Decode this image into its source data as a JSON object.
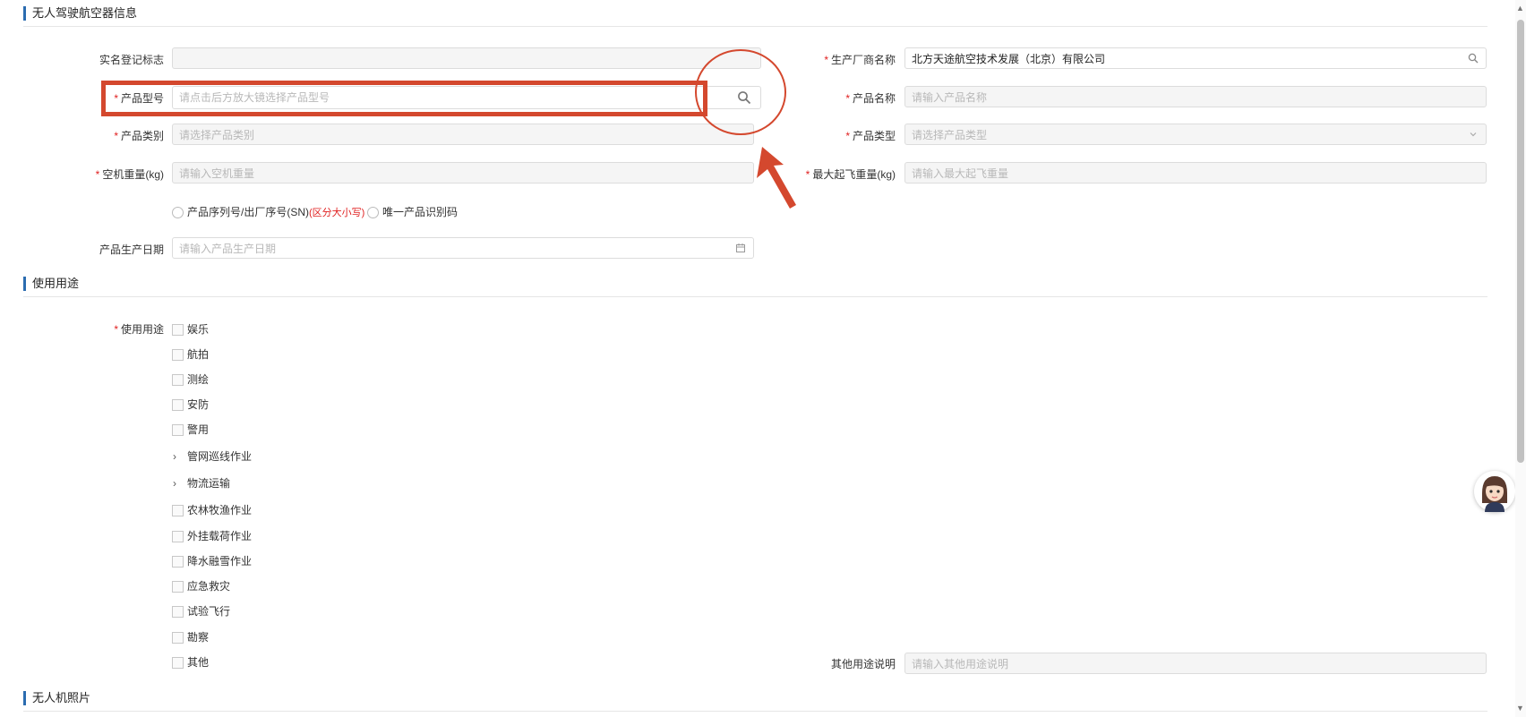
{
  "sections": {
    "uav_info": "无人驾驶航空器信息",
    "usage": "使用用途",
    "photos": "无人机照片"
  },
  "fields": {
    "real_name_flag": {
      "label": "实名登记标志",
      "value": ""
    },
    "manufacturer": {
      "label": "生产厂商名称",
      "value": "北方天途航空技术发展（北京）有限公司"
    },
    "product_model": {
      "label": "产品型号",
      "placeholder": "请点击后方放大镜选择产品型号"
    },
    "product_name": {
      "label": "产品名称",
      "placeholder": "请输入产品名称"
    },
    "product_category": {
      "label": "产品类别",
      "placeholder": "请选择产品类别"
    },
    "product_type": {
      "label": "产品类型",
      "placeholder": "请选择产品类型"
    },
    "empty_weight": {
      "label": "空机重量(kg)",
      "placeholder": "请输入空机重量"
    },
    "max_takeoff_weight": {
      "label": "最大起飞重量(kg)",
      "placeholder": "请输入最大起飞重量"
    },
    "production_date": {
      "label": "产品生产日期",
      "placeholder": "请输入产品生产日期"
    },
    "other_usage": {
      "label": "其他用途说明",
      "placeholder": "请输入其他用途说明"
    }
  },
  "radios": {
    "serial": {
      "label": "产品序列号/出厂序号(SN)",
      "note": "(区分大小写)"
    },
    "udi": {
      "label": "唯一产品识别码"
    }
  },
  "usage": {
    "label": "使用用途",
    "options": [
      {
        "label": "娱乐",
        "kind": "checkbox"
      },
      {
        "label": "航拍",
        "kind": "checkbox"
      },
      {
        "label": "测绘",
        "kind": "checkbox"
      },
      {
        "label": "安防",
        "kind": "checkbox"
      },
      {
        "label": "警用",
        "kind": "checkbox"
      },
      {
        "label": "管网巡线作业",
        "kind": "expand"
      },
      {
        "label": "物流运输",
        "kind": "expand"
      },
      {
        "label": "农林牧渔作业",
        "kind": "checkbox"
      },
      {
        "label": "外挂载荷作业",
        "kind": "checkbox"
      },
      {
        "label": "降水融雪作业",
        "kind": "checkbox"
      },
      {
        "label": "应急救灾",
        "kind": "checkbox"
      },
      {
        "label": "试验飞行",
        "kind": "checkbox"
      },
      {
        "label": "勘察",
        "kind": "checkbox"
      },
      {
        "label": "其他",
        "kind": "checkbox"
      }
    ]
  },
  "required_mark": "*",
  "chevron_glyph": "›",
  "icons": {
    "search": "search-icon",
    "calendar": "calendar-icon",
    "dropdown": "chevron-down-icon",
    "annotation": "red-arrow-annotation"
  },
  "colors": {
    "accent": "#2b6cb0",
    "required": "#e02020",
    "annotation": "#d4482e"
  }
}
